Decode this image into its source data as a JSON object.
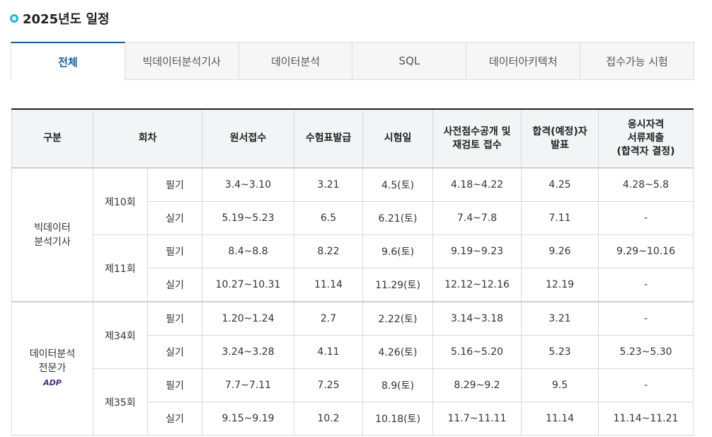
{
  "page": {
    "title": "2025년도 일정"
  },
  "tabs": [
    {
      "label": "전체",
      "active": true
    },
    {
      "label": "빅데이터분석기사",
      "active": false
    },
    {
      "label": "데이터분석",
      "active": false
    },
    {
      "label": "SQL",
      "active": false
    },
    {
      "label": "데이터아키텍처",
      "active": false
    },
    {
      "label": "접수가능 시험",
      "active": false
    }
  ],
  "table": {
    "headers": {
      "category": "구분",
      "round": "회차",
      "application": "원서접수",
      "ticket": "수험표발급",
      "exam_date": "시험일",
      "pre_score_line1": "사전점수공개 및",
      "pre_score_line2": "재검토 접수",
      "result_line1": "합격(예정)자",
      "result_line2": "발표",
      "docs_line1": "응시자격",
      "docs_line2": "서류제출",
      "docs_line3": "(합격자 결정)"
    },
    "exams": [
      {
        "name_line1": "빅데이터",
        "name_line2": "분석기사",
        "logo_text": "",
        "rounds": [
          {
            "label": "제10회",
            "rows": [
              {
                "type": "필기",
                "application": "3.4~3.10",
                "ticket": "3.21",
                "exam_date": "4.5(토)",
                "pre_score": "4.18~4.22",
                "result": "4.25",
                "docs": "4.28~5.8"
              },
              {
                "type": "실기",
                "application": "5.19~5.23",
                "ticket": "6.5",
                "exam_date": "6.21(토)",
                "pre_score": "7.4~7.8",
                "result": "7.11",
                "docs": "-"
              }
            ]
          },
          {
            "label": "제11회",
            "rows": [
              {
                "type": "필기",
                "application": "8.4~8.8",
                "ticket": "8.22",
                "exam_date": "9.6(토)",
                "pre_score": "9.19~9.23",
                "result": "9.26",
                "docs": "9.29~10.16"
              },
              {
                "type": "실기",
                "application": "10.27~10.31",
                "ticket": "11.14",
                "exam_date": "11.29(토)",
                "pre_score": "12.12~12.16",
                "result": "12.19",
                "docs": "-"
              }
            ]
          }
        ]
      },
      {
        "name_line1": "데이터분석",
        "name_line2": "전문가",
        "logo_text": "ADP",
        "rounds": [
          {
            "label": "제34회",
            "rows": [
              {
                "type": "필기",
                "application": "1.20~1.24",
                "ticket": "2.7",
                "exam_date": "2.22(토)",
                "pre_score": "3.14~3.18",
                "result": "3.21",
                "docs": "-"
              },
              {
                "type": "실기",
                "application": "3.24~3.28",
                "ticket": "4.11",
                "exam_date": "4.26(토)",
                "pre_score": "5.16~5.20",
                "result": "5.23",
                "docs": "5.23~5.30"
              }
            ]
          },
          {
            "label": "제35회",
            "rows": [
              {
                "type": "필기",
                "application": "7.7~7.11",
                "ticket": "7.25",
                "exam_date": "8.9(토)",
                "pre_score": "8.29~9.2",
                "result": "9.5",
                "docs": "-"
              },
              {
                "type": "실기",
                "application": "9.15~9.19",
                "ticket": "10.2",
                "exam_date": "10.18(토)",
                "pre_score": "11.7~11.11",
                "result": "11.14",
                "docs": "11.14~11.21"
              }
            ]
          }
        ]
      }
    ]
  },
  "colors": {
    "accent": "#1b5a96",
    "bullet": "#29b3d6",
    "logo": "#4b2c7e"
  }
}
